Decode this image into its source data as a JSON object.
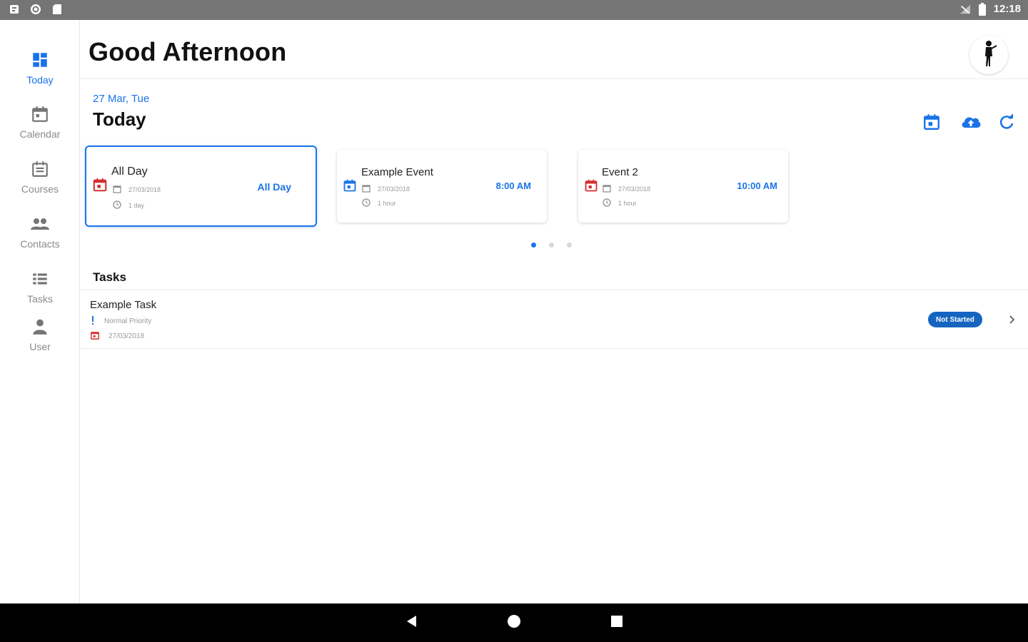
{
  "status_bar": {
    "time": "12:18",
    "left_icons": [
      "notification-icon",
      "sync-icon",
      "sd-card-icon"
    ],
    "right_icons": [
      "no-signal-icon",
      "battery-icon"
    ]
  },
  "sidenav": {
    "items": [
      {
        "label": "Today",
        "icon": "dashboard-icon",
        "active": true
      },
      {
        "label": "Calendar",
        "icon": "calendar-icon",
        "active": false
      },
      {
        "label": "Courses",
        "icon": "courses-icon",
        "active": false
      },
      {
        "label": "Contacts",
        "icon": "contacts-icon",
        "active": false
      },
      {
        "label": "Tasks",
        "icon": "tasks-icon",
        "active": false
      },
      {
        "label": "User",
        "icon": "user-icon",
        "active": false
      }
    ]
  },
  "header": {
    "greeting": "Good Afternoon",
    "avatar_icon": "profile-avatar-icon"
  },
  "today": {
    "date": "27 Mar, Tue",
    "title": "Today",
    "actions": [
      "calendar-today-icon",
      "cloud-upload-icon",
      "refresh-icon"
    ]
  },
  "events": [
    {
      "title": "All Day",
      "date": "27/03/2018",
      "duration": "1 day",
      "time": "All Day",
      "selected": true
    },
    {
      "title": "Example Event",
      "date": "27/03/2018",
      "duration": "1 hour",
      "time": "8:00 AM",
      "selected": false
    },
    {
      "title": "Event 2",
      "date": "27/03/2018",
      "duration": "1 hour",
      "time": "10:00 AM",
      "selected": false
    }
  ],
  "pager": {
    "count": 3,
    "active": 0
  },
  "tasks": {
    "title": "Tasks",
    "items": [
      {
        "name": "Example Task",
        "priority": "Normal Priority",
        "due": "27/03/2018",
        "status": "Not Started"
      }
    ]
  },
  "colors": {
    "accent": "#1a73e8",
    "event_red": "#d32f2f",
    "badge": "#1565c0",
    "status_bar": "#757575"
  }
}
